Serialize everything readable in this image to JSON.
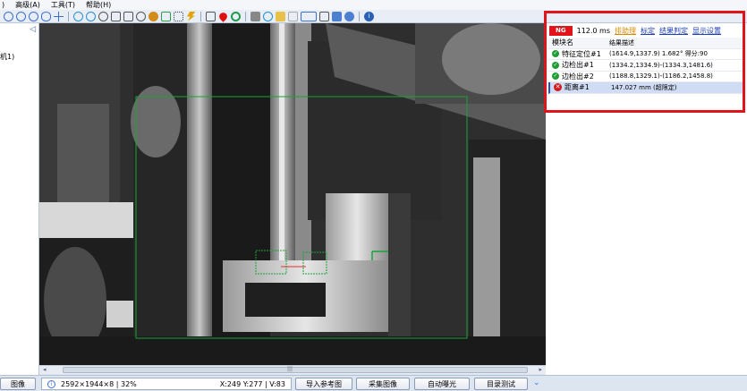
{
  "menubar": {
    "items": [
      ")",
      "高级(A)",
      "工具(T)",
      "帮助(H)"
    ]
  },
  "leftpanel": {
    "item_label": "机1)",
    "collapse_glyph": "◁"
  },
  "toolbar": {
    "icon_colors": [
      "#3d6fd1",
      "#3d6fd1",
      "#3d6fd1",
      "#3d6fd1",
      "#3d6fd1",
      "#2a8fd4",
      "#2a8fd4",
      "#555",
      "#555",
      "#555",
      "#555",
      "#d38b1a",
      "#2aa04a",
      "#444",
      "#e0a400",
      "#d11",
      "#1d9a4b",
      "#555",
      "#1c8fd4",
      "#aaa",
      "#3d6fd1",
      "#555",
      "#4d7fd1",
      "#2a5fb5"
    ]
  },
  "results": {
    "status": "NG",
    "time": "112.0 ms",
    "links": [
      "排助理",
      "标定",
      "结果判定",
      "显示设置"
    ],
    "headers": [
      "模块名",
      "结果描述"
    ],
    "rows": [
      {
        "status": "ok",
        "name": "特征定位#1",
        "desc": "(1614.9,1337.9) 1.682° 得分:90"
      },
      {
        "status": "ok",
        "name": "边检出#1",
        "desc": "(1334.2,1334.9)-(1334.3,1481.6)"
      },
      {
        "status": "ok",
        "name": "边检出#2",
        "desc": "(1188.8,1329.1)-(1186.2,1458.8)"
      },
      {
        "status": "error",
        "name": "距离#1",
        "desc": "147.027 mm (超限定)"
      }
    ]
  },
  "statusbar": {
    "left_button": "图像",
    "image_info": "2592×1944×8 | 32%",
    "coords": "X:249 Y:277 | V:83",
    "buttons": [
      "导入参考图",
      "采集图像",
      "自动曝光",
      "目录测试"
    ]
  },
  "scrollbar": {
    "left_arrow": "◂",
    "right_arrow": "▸",
    "grip": "|||"
  },
  "colors": {
    "ng_red": "#e2141b",
    "highlight_red": "#e2141b",
    "roi_green": "#1aa33a",
    "link_blue": "#1d3fb8"
  }
}
